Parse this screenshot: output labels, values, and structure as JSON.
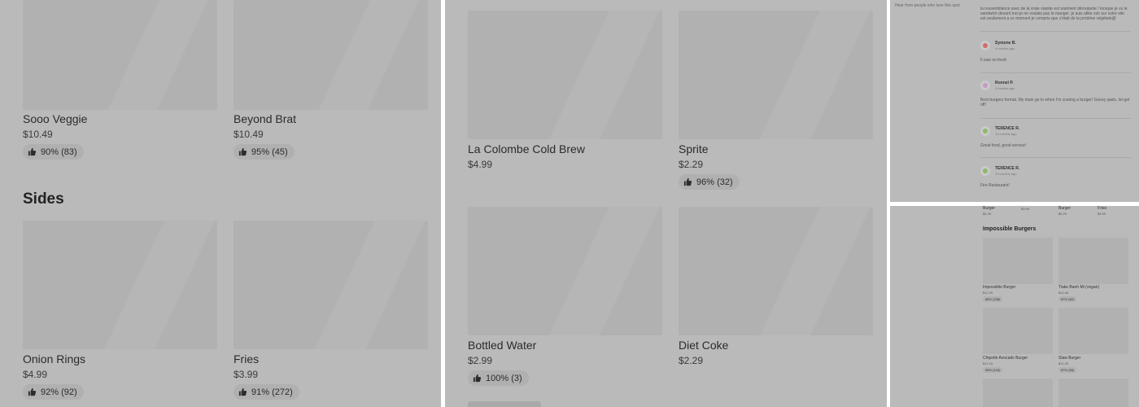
{
  "panel_a": {
    "top_items": [
      {
        "name": "Sooo Veggie",
        "price": "$10.49",
        "rating": "90% (83)"
      },
      {
        "name": "Beyond Brat",
        "price": "$10.49",
        "rating": "95% (45)"
      }
    ],
    "section_title": "Sides",
    "side_items": [
      {
        "name": "Onion Rings",
        "price": "$4.99",
        "rating": "92% (92)"
      },
      {
        "name": "Fries",
        "price": "$3.99",
        "rating": "91% (272)"
      }
    ]
  },
  "panel_b": {
    "items": [
      {
        "name": "La Colombe Cold Brew",
        "price": "$4.99",
        "rating": ""
      },
      {
        "name": "Sprite",
        "price": "$2.29",
        "rating": "96% (32)"
      },
      {
        "name": "Bottled Water",
        "price": "$2.99",
        "rating": "100% (3)"
      },
      {
        "name": "Diet Coke",
        "price": "$2.29",
        "rating": ""
      }
    ]
  },
  "panel_c": {
    "heading": "Hear from people who love this spot",
    "top_review": "la ressemblance avec de la vraie viande est vraiment déroutante ! lorsque je vu le sandwich devant moi je ne voulais pas le manger. je suis allée voir sur votre site est seulement a ce moment je compris que c'était de la protéine végétale@",
    "reviews": [
      {
        "name": "Symone B.",
        "time": "4 months ago",
        "text": "It was so fresh"
      },
      {
        "name": "Ronnel P.",
        "time": "3 months ago",
        "text": "Best burgers format. My main go to when I'm craving a burger! Gooey jawls, let get off!"
      },
      {
        "name": "TERENCE R.",
        "time": "10 months ago",
        "text": "Great food, good service!"
      },
      {
        "name": "TERENCE R.",
        "time": "10 months ago",
        "text": "Fire Restaurant!"
      }
    ],
    "avatar_colors": [
      "#d46a6a",
      "#c79ac2",
      "#8fb86a",
      "#8fb86a"
    ]
  },
  "panel_d": {
    "top_row": [
      {
        "name": "Burger",
        "price": "$2.29"
      },
      {
        "name": "",
        "price": "$3.99"
      },
      {
        "name": "Burger",
        "price": "$2.29"
      },
      {
        "name": "Fries",
        "price": "$4.99"
      }
    ],
    "section_title": "Impossible Burgers",
    "items": [
      {
        "name": "Impossible Burger",
        "price": "$12.29",
        "rating": "88% (238)"
      },
      {
        "name": "Tiake Banh Mi (vegan)",
        "price": "$12.49",
        "rating": "87% (52)"
      },
      {
        "name": "Chipotle Avocado Burger",
        "price": "$12.19",
        "rating": "98% (134)"
      },
      {
        "name": "Slaw Burger",
        "price": "$12.29",
        "rating": "87% (55)"
      }
    ]
  },
  "colors": {
    "overlay": "#bababa",
    "image": "#b1b1b1",
    "chip": "#b0b0b0"
  },
  "icons": {
    "rating": "thumbs-up-icon"
  }
}
